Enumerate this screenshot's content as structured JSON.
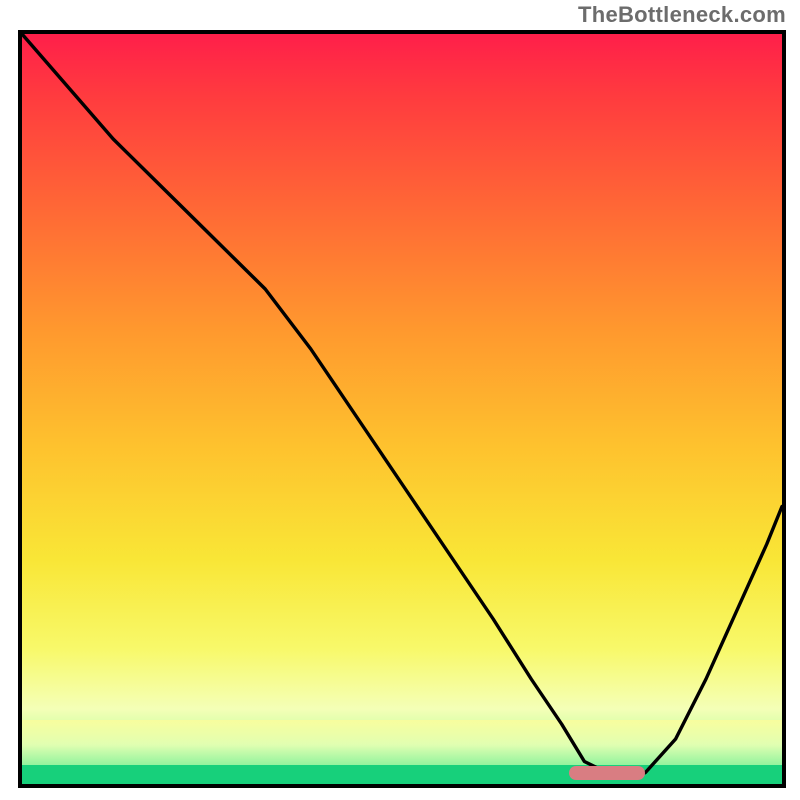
{
  "watermark": "TheBottleneck.com",
  "chart_data": {
    "type": "line",
    "title": "",
    "xlabel": "",
    "ylabel": "",
    "xlim": [
      0,
      100
    ],
    "ylim": [
      0,
      100
    ],
    "grid": false,
    "legend": false,
    "background": "vertical-gradient",
    "gradient_stops": [
      {
        "pos": 0,
        "color": "#ff1f4a"
      },
      {
        "pos": 24,
        "color": "#ff6a35"
      },
      {
        "pos": 55,
        "color": "#fec22e"
      },
      {
        "pos": 82,
        "color": "#f8f96a"
      },
      {
        "pos": 97,
        "color": "#60f08d"
      },
      {
        "pos": 100,
        "color": "#17d07b"
      }
    ],
    "series": [
      {
        "name": "bottleneck-curve",
        "color": "#000000",
        "x": [
          0,
          6,
          12,
          18,
          24,
          28,
          32,
          38,
          44,
          50,
          56,
          62,
          67,
          71,
          74,
          77,
          79,
          82,
          86,
          90,
          94,
          98,
          100
        ],
        "y": [
          100,
          93,
          86,
          80,
          74,
          70,
          66,
          58,
          49,
          40,
          31,
          22,
          14,
          8,
          3,
          1.5,
          1.5,
          1.5,
          6,
          14,
          23,
          32,
          37
        ]
      }
    ],
    "marker": {
      "name": "optimal-range",
      "color": "#d97d82",
      "x_start": 72,
      "x_end": 82,
      "y": 1.5
    }
  }
}
